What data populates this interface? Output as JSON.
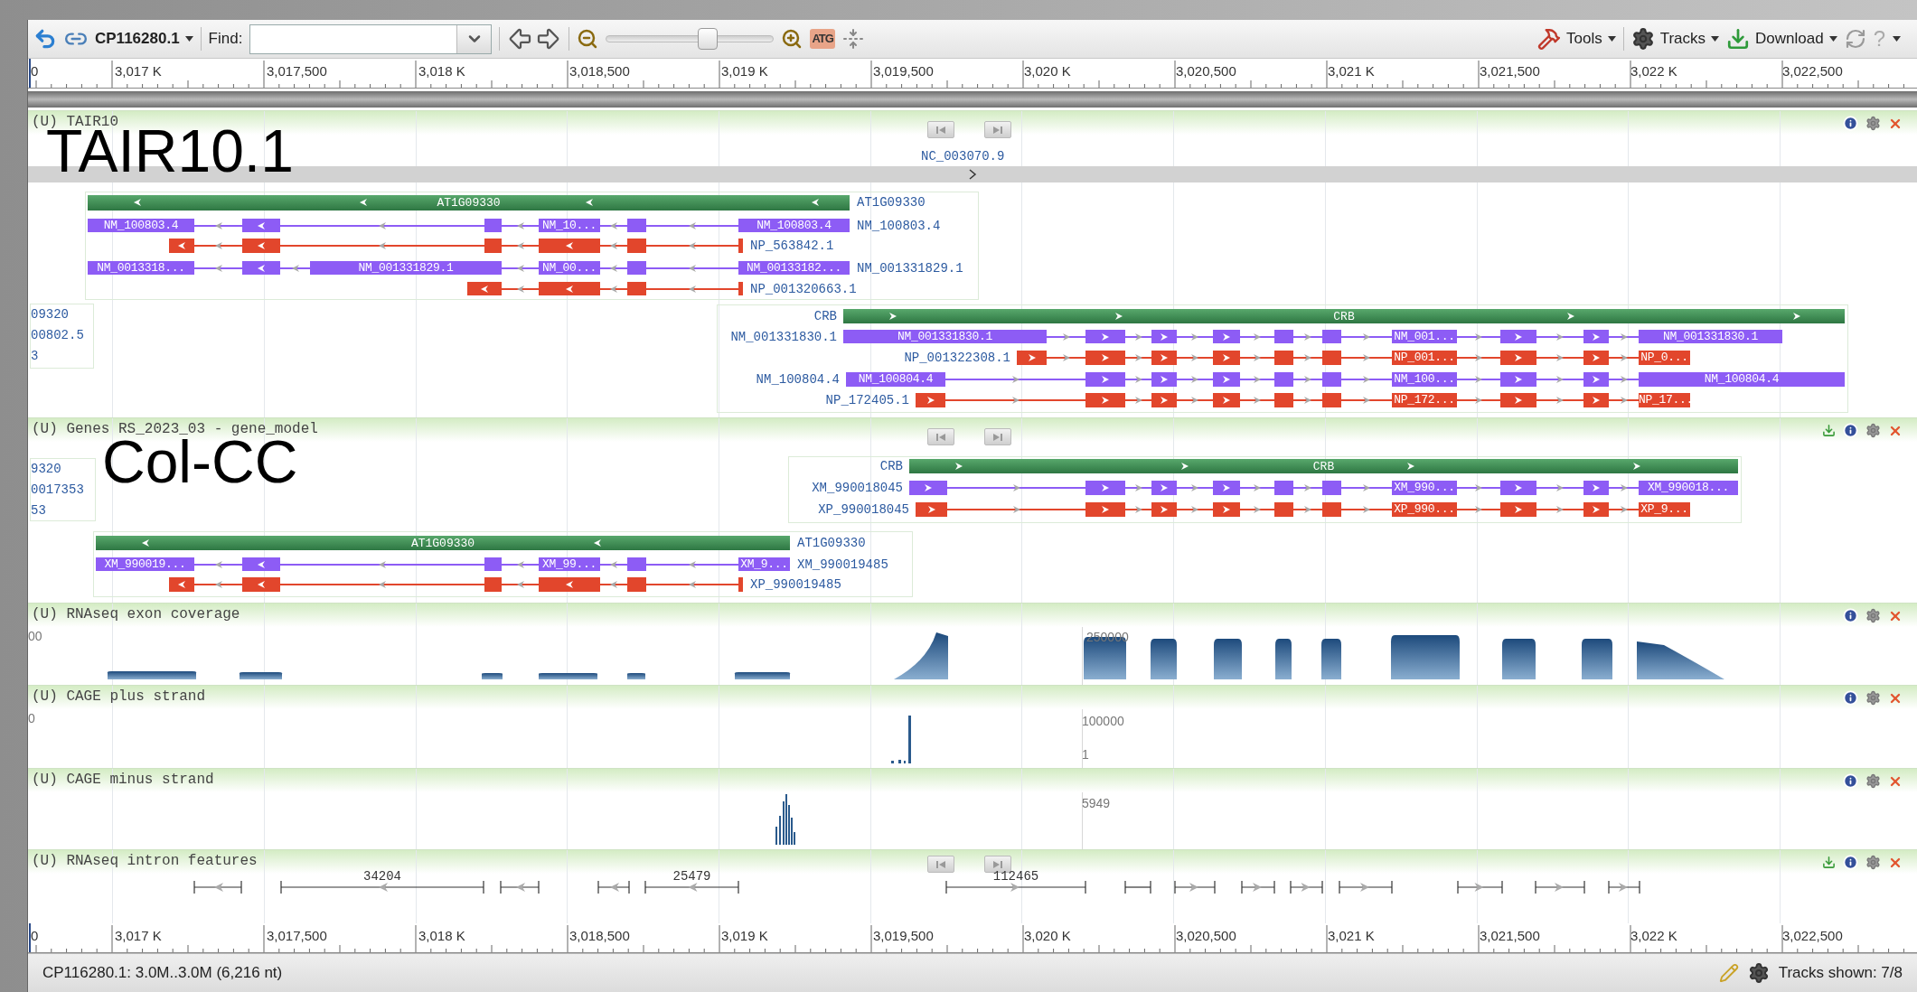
{
  "toolbar": {
    "sequence": "CP116280.1",
    "find_label": "Find:",
    "zoom_slider": {
      "level": 0.62
    },
    "sequence_button": "ATG",
    "menus": [
      "Tools",
      "Tracks",
      "Download"
    ],
    "help": "?"
  },
  "ruler_top": {
    "labels": [
      "0",
      "3,017 K",
      "3,017,500",
      "3,018 K",
      "3,018,500",
      "3,019 K",
      "3,019,500",
      "3,020 K",
      "3,020,500",
      "3,021 K",
      "3,021,500",
      "3,022 K",
      "3,022,500"
    ]
  },
  "tracks": [
    {
      "kind": "genes",
      "title": "(U) TAIR10",
      "overlay": "TAIR10.1",
      "download": false,
      "nav": true,
      "sequence": "NC_003070.9",
      "groups": [
        {
          "kind": "gene",
          "gene": "AT1G09330",
          "bar_label": "AT1G09330",
          "transcripts": [
            {
              "kind": "mrna",
              "name": "NM_100803.4",
              "exon_labels": [
                "NM_100803.4",
                "NM_10...",
                "NM_100803.4"
              ]
            },
            {
              "kind": "protein",
              "name": "NP_563842.1"
            },
            {
              "kind": "mrna",
              "name": "NM_001331829.1",
              "exon_labels": [
                "NM_0013318...",
                "NM_001331829.1",
                "NM_00...",
                "NM_00133182..."
              ]
            },
            {
              "kind": "protein",
              "name": "NP_001320663.1"
            }
          ]
        },
        {
          "kind": "partial",
          "labels": [
            "09320",
            "00802.5",
            "3"
          ]
        },
        {
          "kind": "gene",
          "gene": "CRB",
          "bar_label": "CRB",
          "transcripts": [
            {
              "kind": "mrna",
              "name": "NM_001331830.1",
              "exon_labels": [
                "NM_001331830.1",
                "NM_001...",
                "NM_001331830.1"
              ]
            },
            {
              "kind": "protein",
              "name": "NP_001322308.1",
              "exon_labels": [
                "NP_001...",
                "NP_0..."
              ]
            },
            {
              "kind": "mrna",
              "name": "NM_100804.4",
              "exon_labels": [
                "NM_100804.4",
                "NM_100...",
                "NM_100804.4"
              ]
            },
            {
              "kind": "protein",
              "name": "NP_172405.1",
              "exon_labels": [
                "NP_172...",
                "NP_17..."
              ]
            }
          ]
        }
      ]
    },
    {
      "kind": "genes",
      "title": "(U) Genes RS_2023_03 - gene_model",
      "overlay": "Col-CC",
      "download": true,
      "nav": true,
      "groups": [
        {
          "kind": "partial",
          "labels": [
            "9320",
            "0017353",
            "53"
          ]
        },
        {
          "kind": "gene",
          "gene": "CRB",
          "bar_label": "CRB",
          "transcripts": [
            {
              "kind": "mrna",
              "name": "XM_990018045",
              "exon_labels": [
                "XM_990...",
                "XM_990018..."
              ]
            },
            {
              "kind": "protein",
              "name": "XP_990018045",
              "exon_labels": [
                "XP_990...",
                "XP_9..."
              ]
            }
          ]
        },
        {
          "kind": "gene",
          "gene": "AT1G09330",
          "bar_label": "AT1G09330",
          "transcripts": [
            {
              "kind": "mrna",
              "name": "XM_990019485",
              "exon_labels": [
                "XM_990019...",
                "XM_99...",
                "XM_9..."
              ]
            },
            {
              "kind": "protein",
              "name": "XP_990019485"
            }
          ]
        }
      ]
    },
    {
      "kind": "coverage",
      "title": "(U) RNAseq exon coverage",
      "download": false,
      "nav": false,
      "labels": [
        "00",
        "250000"
      ]
    },
    {
      "kind": "cage_plus",
      "title": "(U) CAGE plus strand",
      "download": false,
      "nav": false,
      "labels": [
        "0",
        "100000",
        "1"
      ]
    },
    {
      "kind": "cage_minus",
      "title": "(U) CAGE minus strand",
      "download": false,
      "nav": false,
      "labels": [
        "5949"
      ]
    },
    {
      "kind": "introns",
      "title": "(U) RNAseq intron features",
      "download": true,
      "nav": true,
      "intron_labels": [
        "34204",
        "25479",
        "112465"
      ]
    }
  ],
  "ruler_bottom": {
    "labels": [
      "0",
      "3,017 K",
      "3,017,500",
      "3,018 K",
      "3,018,500",
      "3,019 K",
      "3,019,500",
      "3,020 K",
      "3,020,500",
      "3,021 K",
      "3,021,500",
      "3,022 K",
      "3,022,500"
    ]
  },
  "status_bar": {
    "location": "CP116280.1: 3.0M..3.0M (6,216 nt)",
    "tracks_shown": "Tracks shown: 7/8"
  }
}
